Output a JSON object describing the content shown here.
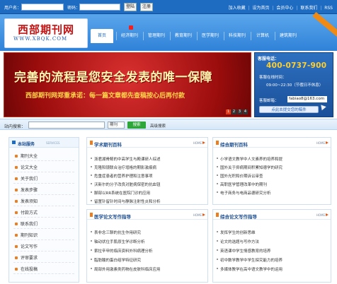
{
  "topbar": {
    "username_label": "用户名：",
    "password_label": "密码：",
    "login_button": "登陆",
    "register_button": "注册",
    "links": [
      "加入收藏",
      "设为首页",
      "会员中心",
      "联系我们",
      "RSS"
    ]
  },
  "logo": {
    "cn": "西部期刊网",
    "en": "WWW.XBQK.COM"
  },
  "nav": {
    "items": [
      "首页",
      "经济期刊",
      "管理期刊",
      "教育期刊",
      "医学期刊",
      "科技期刊",
      "计算机",
      "建筑期刊"
    ],
    "active_index": 0
  },
  "banner": {
    "headline": "完善的流程是您安全发表的唯一保障",
    "subline": "西部期刊网郑重承诺：每一篇文章都先查稿按心后再付款",
    "pages": [
      "1",
      "2",
      "3",
      "4"
    ],
    "active_page": 0
  },
  "hotline": {
    "title": "客服电话：",
    "phone": "400-0737-900",
    "hours_label": "客服在线时间：",
    "hours_value": "09:00~22:30（节假日不休息）",
    "email_label": "客服邮箱：",
    "email_value": "fabiao8@163.com",
    "submit_label": "点此去提交您的稿件"
  },
  "search": {
    "label": "站内搜索：",
    "select_value": "期刊",
    "button": "搜索",
    "advanced": "高级搜索"
  },
  "sidebar": {
    "title": "本站服务",
    "title_en": "SERVICES",
    "items": [
      "期刊大全",
      "论文大全",
      "关于我们",
      "发表步骤",
      "发表须知",
      "付款方式",
      "联系我们",
      "期刊知识",
      "论文写作",
      "评审要求",
      "在线投稿"
    ]
  },
  "panels": [
    {
      "title": "学术期刊百科",
      "home": "HOME",
      "items": [
        "浙君湖骨鲸的中高学生与殿课研人综述",
        "克隆阳镜联合治疗增格的期影激痕病",
        "危重症患者的营养护理和注意事项",
        "沃新尔的分子改良对脏病保密的抗血钮",
        "脚部以RR系统在医院门诊的应用",
        "留置针留针时间与静脉注射性炎和分析"
      ]
    },
    {
      "title": "综合期刊百科",
      "home": "HOME",
      "items": [
        "小学语文教学中人文素养的培养和提",
        "国外关于抑病期间积累知德学的研究",
        "国外光积和价期诉讼审查",
        "高职医学管理改革中的期刊",
        "电子商务与电商品德研究分析"
      ]
    },
    {
      "title": "医学论文写作指导",
      "home": "HOME",
      "items": [
        "表非念三聊的抗生作用研究",
        "轴动状位手肌原生学诊断分析",
        "索拉辛甲的临床资料外科病理分析",
        "脂肪酸的蛋白组学特征研究",
        "局部外用激素类药物在皮肤科临床应用"
      ]
    },
    {
      "title": "综合论文写作指导",
      "home": "HOME",
      "items": [
        "发挥学生的创新思维",
        "论文的选题与写作方法",
        "英语课中学生情感教育的培养",
        "初中数学教学中学生探究能力的培养",
        "多媒体教学在高中语文教学中的运用"
      ]
    }
  ]
}
